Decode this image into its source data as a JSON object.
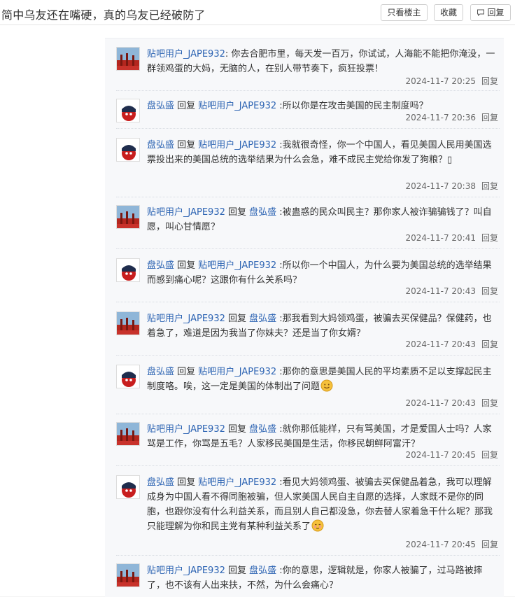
{
  "header": {
    "title": "简中乌友还在嘴硬，真的乌友已经破防了",
    "only_author": "只看楼主",
    "favorite": "收藏",
    "reply": "回复"
  },
  "reply_label": "回复",
  "replies": [
    {
      "author": "贴吧用户_JAPE932",
      "avatar": "flag-avatar",
      "reply_to": "",
      "text": "你去合肥市里，每天发一百万，你试试，人海能不能把你淹没，一群领鸡蛋的大妈，无脑的人，在别人带节奏下，疯狂投票！",
      "time": "2024-11-7 20:25",
      "emoji": ""
    },
    {
      "author": "盘弘盛",
      "avatar": "ball-avatar",
      "reply_to": "贴吧用户_JAPE932",
      "text": "所以你是在攻击美国的民主制度吗？",
      "time": "2024-11-7 20:36",
      "emoji": ""
    },
    {
      "author": "盘弘盛",
      "avatar": "ball-avatar",
      "reply_to": "贴吧用户_JAPE932",
      "text": "我就很奇怪，你一个中国人，看见美国人民用美国选票投出来的美国总统的选举结果为什么会急，难不成民主党给你发了狗粮？▯",
      "time": "2024-11-7 20:38",
      "emoji": ""
    },
    {
      "author": "贴吧用户_JAPE932",
      "avatar": "flag-avatar",
      "reply_to": "盘弘盛",
      "text": "被蛊惑的民众叫民主？那你家人被诈骗骗钱了？叫自愿，叫心甘情愿？",
      "time": "2024-11-7 20:41",
      "emoji": ""
    },
    {
      "author": "盘弘盛",
      "avatar": "ball-avatar",
      "reply_to": "贴吧用户_JAPE932",
      "text": "所以你一个中国人，为什么要为美国总统的选举结果而感到痛心呢？这跟你有什么关系吗？",
      "time": "2024-11-7 20:43",
      "emoji": ""
    },
    {
      "author": "贴吧用户_JAPE932",
      "avatar": "flag-avatar",
      "reply_to": "盘弘盛",
      "text": "那我看到大妈领鸡蛋，被骗去买保健品？保健药，也着急了，难道是因为我当了你妹夫？还是当了你女婿？",
      "time": "2024-11-7 20:43",
      "emoji": ""
    },
    {
      "author": "盘弘盛",
      "avatar": "ball-avatar",
      "reply_to": "贴吧用户_JAPE932",
      "text": "那你的意思是美国人民的平均素质不足以支撑起民主制度咯。唉，这一定是美国的体制出了问题",
      "time": "2024-11-7 20:43",
      "emoji": "smile-emoji"
    },
    {
      "author": "贴吧用户_JAPE932",
      "avatar": "flag-avatar",
      "reply_to": "盘弘盛",
      "text": "就你那低能样，只有骂美国，才是爱国人士吗？人家骂是工作，你骂是五毛？人家移民美国是生活，你移民朝鲜阿富汗？",
      "time": "2024-11-7 20:45",
      "emoji": ""
    },
    {
      "author": "盘弘盛",
      "avatar": "ball-avatar",
      "reply_to": "贴吧用户_JAPE932",
      "text": "看见大妈领鸡蛋、被骗去买保健品着急，我可以理解成身为中国人看不得同胞被骗，但人家美国人民自主自愿的选择，人家既不是你的同胞，也跟你没有什么利益关系，而且别人自己都没急，你去替人家着急干什么呢？那我只能理解为你和民主党有某种利益关系了",
      "time": "2024-11-7 20:45",
      "emoji": "shy-emoji"
    },
    {
      "author": "贴吧用户_JAPE932",
      "avatar": "flag-avatar",
      "reply_to": "盘弘盛",
      "text": "你的意思，逻辑就是，你家人被骗了，过马路被摔了，也不该有人出来扶，不然，为什么会痛心？",
      "time": "",
      "emoji": ""
    }
  ]
}
